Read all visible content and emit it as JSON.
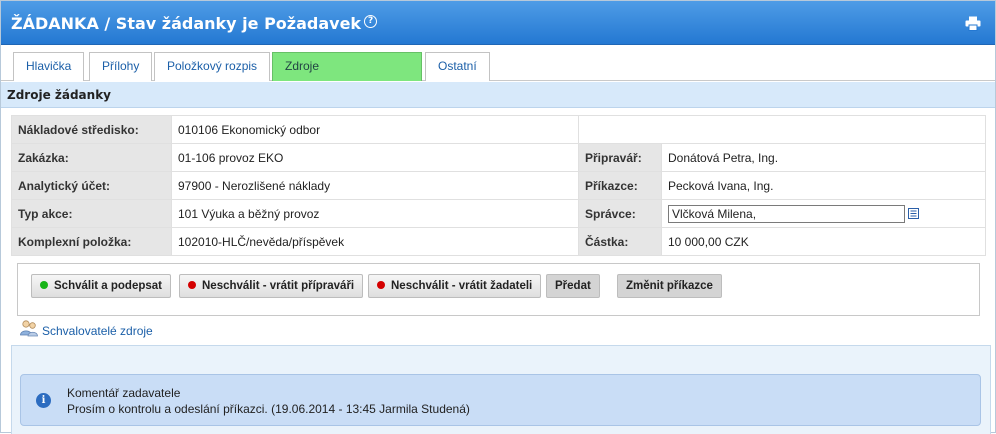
{
  "header": {
    "title": "ŽÁDANKA / Stav žádanky je Požadavek",
    "help_glyph": "?"
  },
  "tabs": [
    {
      "label": "Hlavička"
    },
    {
      "label": "Přílohy"
    },
    {
      "label": "Položkový rozpis"
    },
    {
      "label": "Zdroje",
      "active": true
    },
    {
      "label": "Ostatní"
    }
  ],
  "section": {
    "title": "Zdroje žádanky"
  },
  "fields": {
    "nakladove_stredisko": {
      "label": "Nákladové středisko:",
      "value": "010106 Ekonomický odbor"
    },
    "zakazka": {
      "label": "Zakázka:",
      "value": "01-106 provoz EKO"
    },
    "pripravar": {
      "label": "Připravář:",
      "value": "Donátová Petra, Ing."
    },
    "analyticky_ucet": {
      "label": "Analytický účet:",
      "value": "97900 - Nerozlišené náklady"
    },
    "prikazce": {
      "label": "Příkazce:",
      "value": "Pecková Ivana, Ing."
    },
    "typ_akce": {
      "label": "Typ akce:",
      "value": "101 Výuka a běžný provoz"
    },
    "spravce": {
      "label": "Správce:",
      "value": "Vlčková Milena,"
    },
    "komplexni_polozka": {
      "label": "Komplexní položka:",
      "value": "102010-HLČ/nevěda/příspěvek"
    },
    "castka": {
      "label": "Částka:",
      "value": "10 000,00 CZK"
    }
  },
  "actions": {
    "approve": "Schválit a podepsat",
    "reject_preparer": "Neschválit - vrátit přípraváři",
    "reject_requester": "Neschválit - vrátit žadateli",
    "forward": "Předat",
    "change_authorizer": "Změnit příkazce"
  },
  "approvers_link": "Schvalovatelé zdroje",
  "comment": {
    "title": "Komentář zadavatele",
    "text": "Prosím o kontrolu a odeslání příkazci. (19.06.2014 - 13:45 Jarmila Studená)",
    "icon_glyph": "i"
  },
  "colors": {
    "header_blue": "#2478d2",
    "active_tab": "#7ee67e",
    "section_bg": "#d7e9fa",
    "approve_dot": "#17b417",
    "reject_dot": "#d40000",
    "comment_bg": "#c9ddf6"
  },
  "icons": {
    "help": "help-icon",
    "print": "print-icon",
    "list": "list-icon",
    "approvers": "users-icon",
    "info": "info-icon"
  }
}
